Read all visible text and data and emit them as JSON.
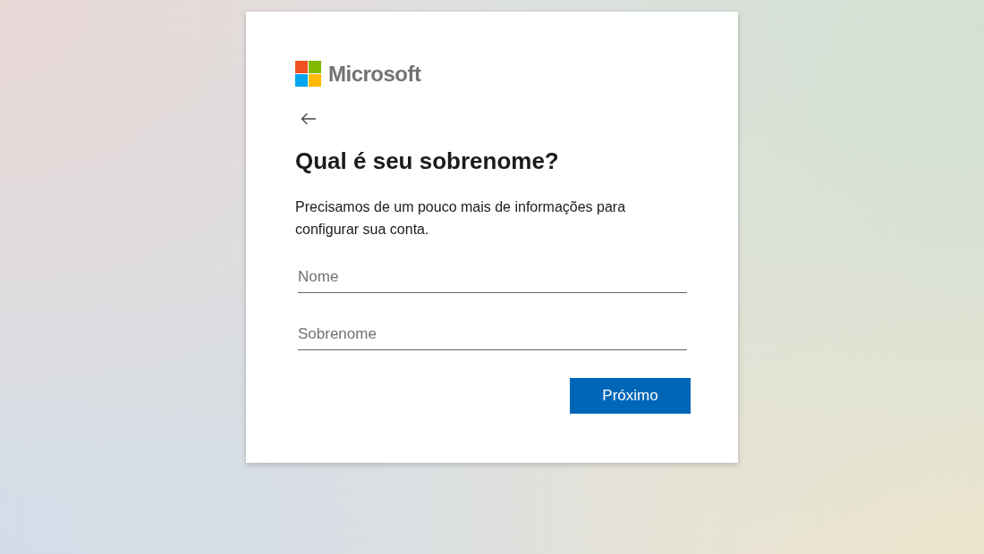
{
  "card": {
    "brand": "Microsoft",
    "title": "Qual é seu sobrenome?",
    "description": "Precisamos de um pouco mais de informações para configurar sua conta.",
    "fields": [
      {
        "kind": "text",
        "placeholder": "Nome"
      },
      {
        "kind": "text",
        "placeholder": "Sobrenome"
      }
    ],
    "button": "Próximo"
  }
}
